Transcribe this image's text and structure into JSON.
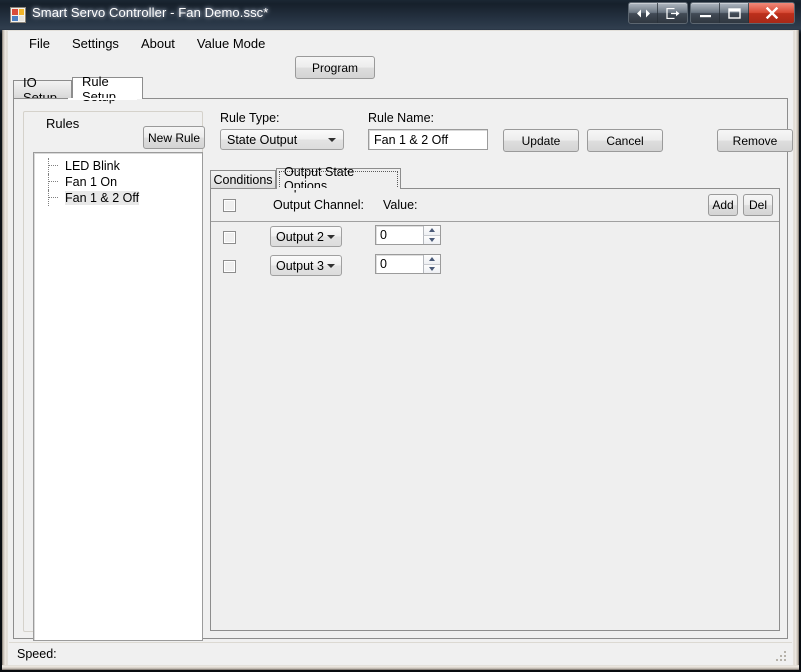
{
  "window": {
    "title": "Smart Servo Controller - Fan Demo.ssc*",
    "icon": "app-squares-icon",
    "controls": {
      "extra1": "resize-arrows-icon",
      "extra2": "restore-export-icon",
      "minimize": "minimize-icon",
      "maximize": "maximize-icon",
      "close": "close-icon"
    }
  },
  "menu": {
    "items": [
      {
        "label": "File"
      },
      {
        "label": "Settings"
      },
      {
        "label": "About"
      },
      {
        "label": "Value Mode"
      }
    ]
  },
  "toolbar": {
    "program_label": "Program"
  },
  "outer_tabs": {
    "selected": "Rule Setup",
    "items": [
      {
        "label": "IO Setup"
      },
      {
        "label": "Rule Setup"
      }
    ]
  },
  "rules_group": {
    "title": "Rules",
    "new_rule_label": "New Rule",
    "tree": [
      {
        "label": "LED Blink",
        "selected": false
      },
      {
        "label": "Fan 1 On",
        "selected": false
      },
      {
        "label": "Fan 1 & 2 Off",
        "selected": true
      }
    ]
  },
  "detail": {
    "rule_type_label": "Rule Type:",
    "rule_type_value": "State Output",
    "rule_name_label": "Rule Name:",
    "rule_name_value": "Fan 1 & 2 Off",
    "rule_name_placeholder": "",
    "update_label": "Update",
    "cancel_label": "Cancel",
    "remove_label": "Remove"
  },
  "inner_tabs": {
    "selected": "Output State Options",
    "items": [
      {
        "label": "Conditions"
      },
      {
        "label": "Output State Options"
      }
    ]
  },
  "output_grid": {
    "headers": {
      "output_channel": "Output Channel:",
      "value": "Value:"
    },
    "add_label": "Add",
    "del_label": "Del",
    "rows": [
      {
        "checked": false,
        "channel": "Output 2",
        "value": "0"
      },
      {
        "checked": false,
        "channel": "Output 3",
        "value": "0"
      }
    ]
  },
  "status_bar": {
    "text": "Speed:"
  },
  "colors": {
    "accent": "#2d3b4b",
    "close_button": "#d84a35",
    "window_bg": "#f0f0f0",
    "panel_bg": "#efefef",
    "field_bg": "#ffffff"
  }
}
